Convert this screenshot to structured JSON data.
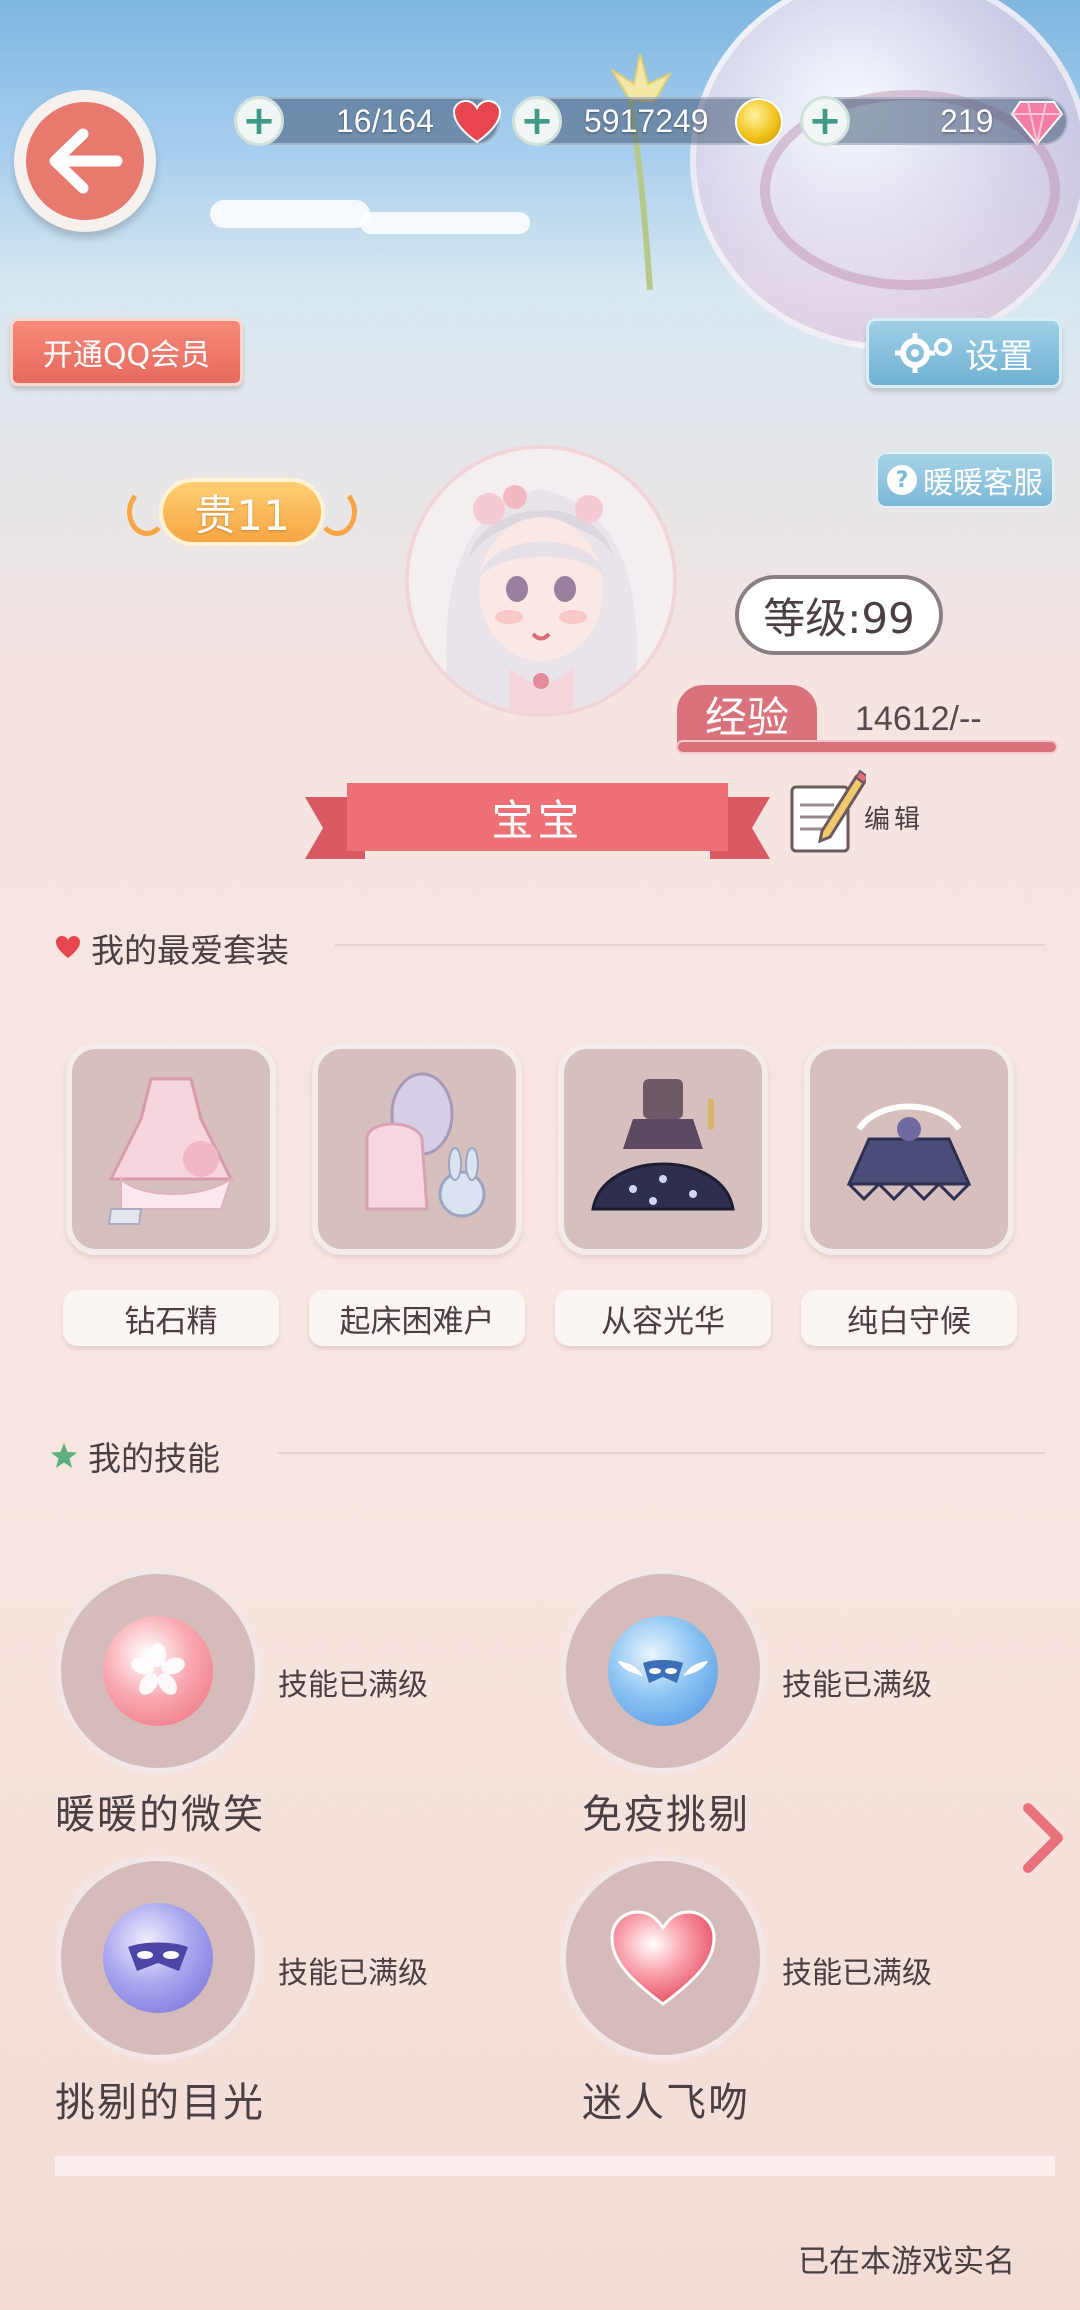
{
  "topbar": {
    "back_icon": "back-arrow-icon",
    "stamina": {
      "value": "16/164",
      "icon": "heart-icon"
    },
    "gold": {
      "value": "5917249",
      "icon": "gold-coin-icon"
    },
    "diamonds": {
      "value": "219",
      "icon": "diamond-icon"
    },
    "plus_icon": "plus-icon"
  },
  "actions": {
    "qq_member": "开通QQ会员",
    "settings": "设置",
    "customer_service": "暖暖客服"
  },
  "profile": {
    "vip_label": "贵11",
    "level_label": "等级:99",
    "exp_label": "经验",
    "exp_value": "14612/--",
    "name": "宝宝",
    "edit_label": "编辑"
  },
  "favorites": {
    "title": "我的最爱套装",
    "items": [
      {
        "label": "钻石精"
      },
      {
        "label": "起床困难户"
      },
      {
        "label": "从容光华"
      },
      {
        "label": "纯白守候"
      }
    ]
  },
  "skills": {
    "title": "我的技能",
    "items": [
      {
        "name": "暖暖的微笑",
        "status": "技能已满级",
        "icon": "sakura-icon",
        "color": "#f07a84"
      },
      {
        "name": "免疫挑剔",
        "status": "技能已满级",
        "icon": "winged-mask-icon",
        "color": "#5fa4e8"
      },
      {
        "name": "挑剔的目光",
        "status": "技能已满级",
        "icon": "mask-icon",
        "color": "#7b79e0"
      },
      {
        "name": "迷人飞吻",
        "status": "技能已满级",
        "icon": "heart-icon",
        "color": "#f0687a"
      }
    ]
  },
  "footer": {
    "realname_status": "已在本游戏实名"
  },
  "colors": {
    "accent_red": "#e8796f",
    "ribbon": "#ee6f74",
    "settings_blue": "#6fb1d2",
    "vip_gold": "#f7a644"
  }
}
